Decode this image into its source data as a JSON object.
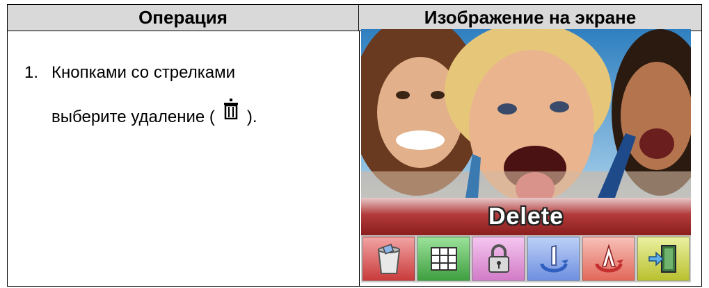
{
  "table": {
    "header_operation": "Операция",
    "header_screen": "Изображение на экране"
  },
  "operation": {
    "step_number": "1.",
    "line1": "Кнопками со стрелками",
    "line2_before": "выберите удаление (",
    "line2_after": ").",
    "inline_icon": "trash-icon"
  },
  "screen": {
    "banner_label": "Delete",
    "menu_icons": [
      {
        "name": "delete-bin-icon",
        "color": "#d94b4b"
      },
      {
        "name": "thumbnail-grid-icon",
        "color": "#4caf50"
      },
      {
        "name": "lock-icon",
        "color": "#e08ad6"
      },
      {
        "name": "rotate-one-icon",
        "color": "#6f8fe0"
      },
      {
        "name": "rotate-all-icon",
        "color": "#e86a5a"
      },
      {
        "name": "exit-door-icon",
        "color": "#c9d13a"
      }
    ]
  }
}
